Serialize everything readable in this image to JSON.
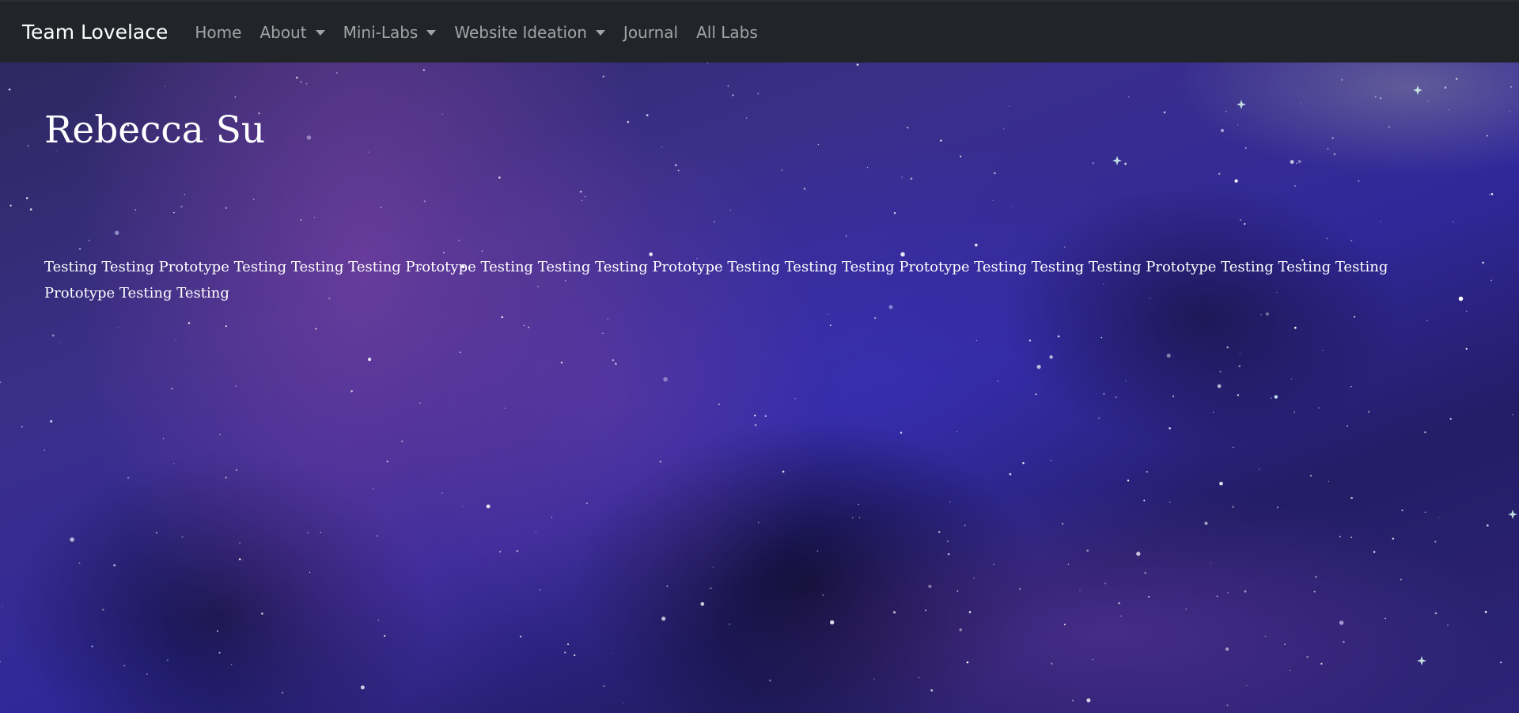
{
  "navbar": {
    "brand": "Team Lovelace",
    "items": [
      {
        "label": "Home",
        "dropdown": false
      },
      {
        "label": "About",
        "dropdown": true
      },
      {
        "label": "Mini-Labs",
        "dropdown": true
      },
      {
        "label": "Website Ideation",
        "dropdown": true
      },
      {
        "label": "Journal",
        "dropdown": false
      },
      {
        "label": "All Labs",
        "dropdown": false
      }
    ]
  },
  "main": {
    "title": "Rebecca Su",
    "body": "Testing Testing Prototype Testing Testing Testing Prototype Testing Testing Testing Prototype Testing Testing Testing Prototype Testing Testing Testing Prototype Testing Testing Testing Prototype Testing Testing"
  },
  "colors": {
    "navbar_bg": "#212529",
    "nav_text": "rgba(255,255,255,0.58)",
    "brand_text": "#ffffff",
    "hero_base": "#30289a"
  }
}
